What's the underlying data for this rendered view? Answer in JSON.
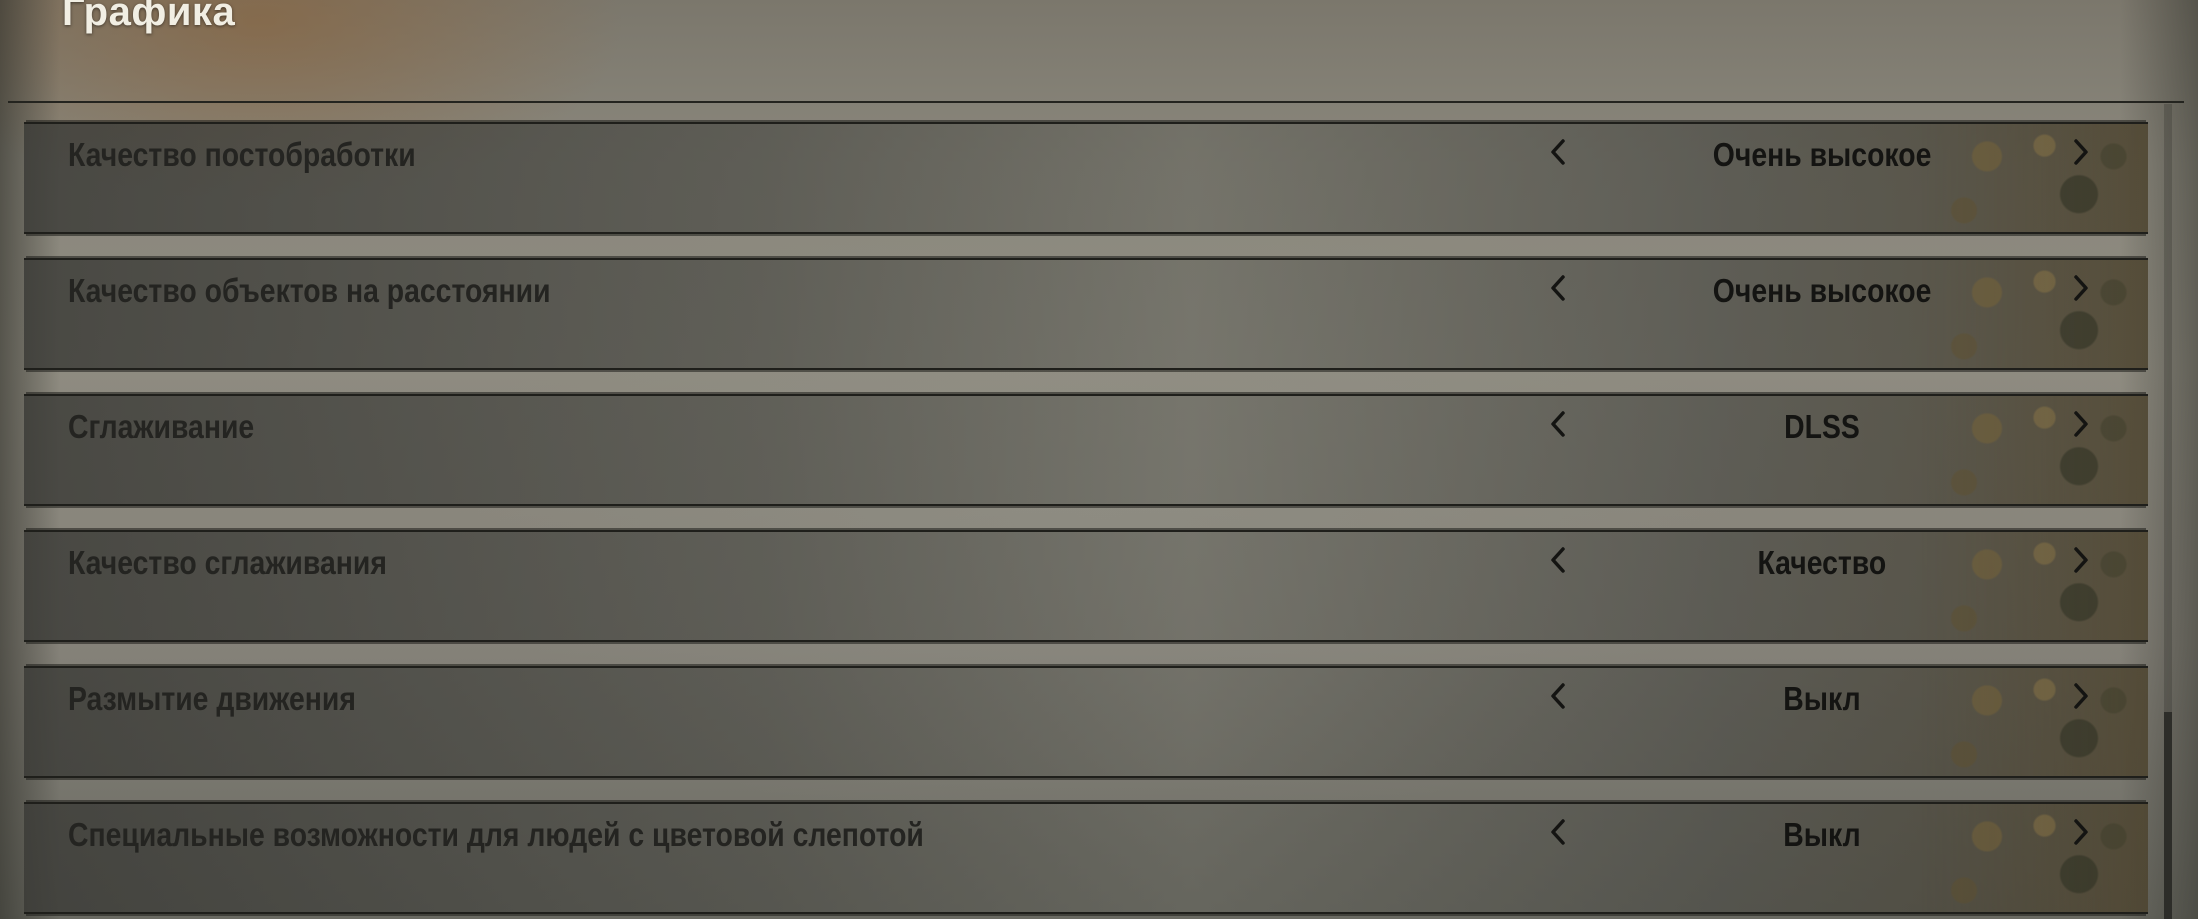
{
  "page_title": "Графика",
  "arrow_icons": {
    "left": "chevron-left-icon",
    "right": "chevron-right-icon"
  },
  "settings": [
    {
      "label": "Качество постобработки",
      "value": "Очень высокое"
    },
    {
      "label": "Качество объектов на расстоянии",
      "value": "Очень высокое"
    },
    {
      "label": "Сглаживание",
      "value": "DLSS"
    },
    {
      "label": "Качество сглаживания",
      "value": "Качество"
    },
    {
      "label": "Размытие движения",
      "value": "Выкл"
    },
    {
      "label": "Специальные возможности для людей с цветовой слепотой",
      "value": "Выкл"
    }
  ],
  "colors": {
    "title_text": "#f1eee3",
    "label_text": "#242421",
    "value_text": "#141412",
    "row_border": "#1f1f1b"
  }
}
